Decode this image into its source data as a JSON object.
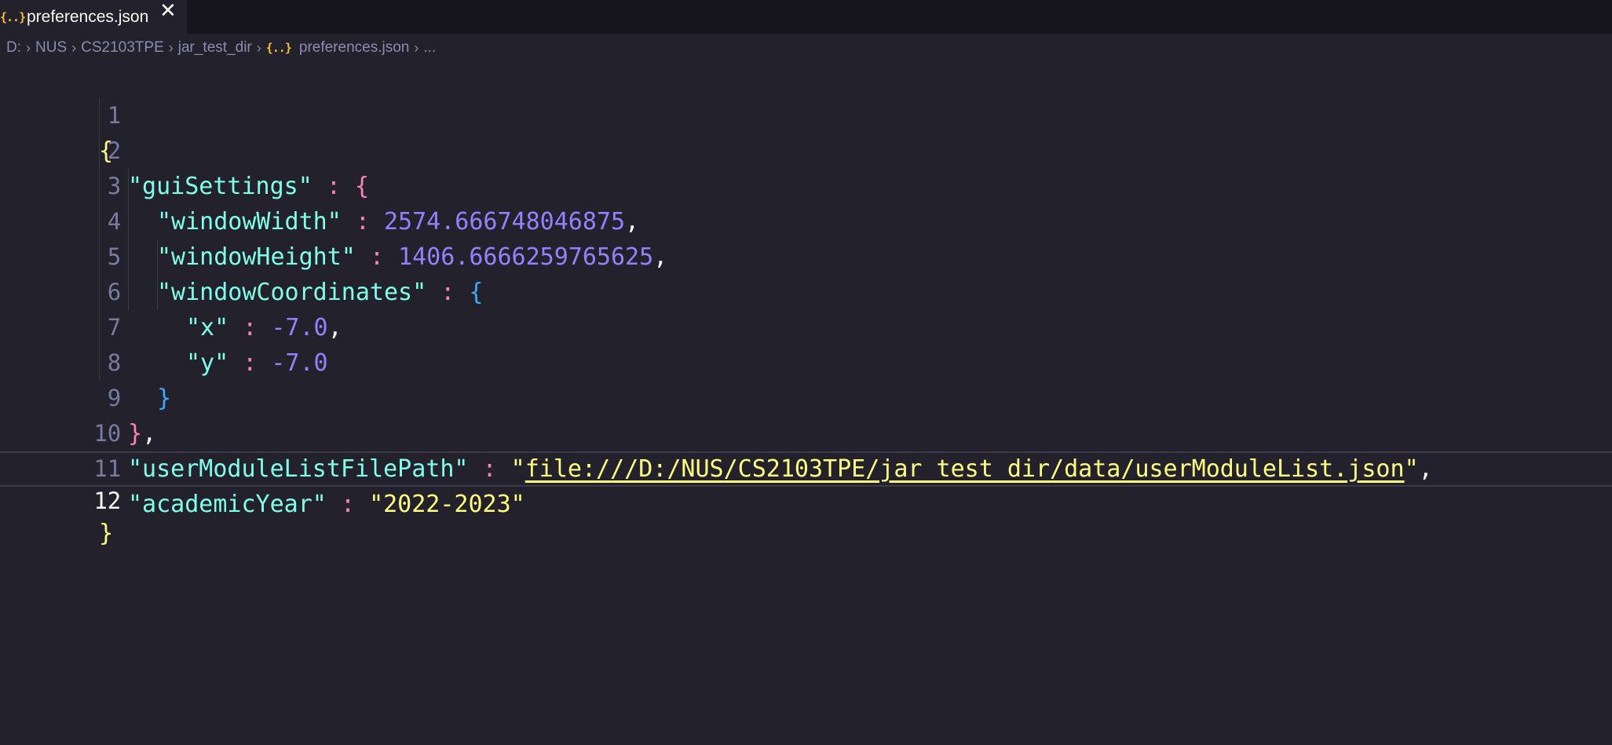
{
  "tab": {
    "icon": "{..}",
    "label": "preferences.json",
    "close": "✕"
  },
  "breadcrumb": {
    "items": [
      "D:",
      "NUS",
      "CS2103TPE",
      "jar_test_dir"
    ],
    "file_icon": "{..}",
    "file": "preferences.json",
    "tail": "..."
  },
  "editor": {
    "current_line": 12,
    "lines": [
      {
        "num": "1"
      },
      {
        "num": "2",
        "key": "\"guiSettings\"",
        "colon": ":",
        "open": "{"
      },
      {
        "num": "3",
        "key": "\"windowWidth\"",
        "colon": ":",
        "value": "2574.666748046875",
        "comma": ","
      },
      {
        "num": "4",
        "key": "\"windowHeight\"",
        "colon": ":",
        "value": "1406.6666259765625",
        "comma": ","
      },
      {
        "num": "5",
        "key": "\"windowCoordinates\"",
        "colon": ":",
        "open": "{"
      },
      {
        "num": "6",
        "key": "\"x\"",
        "colon": ":",
        "value": "-7.0",
        "comma": ","
      },
      {
        "num": "7",
        "key": "\"y\"",
        "colon": ":",
        "value": "-7.0"
      },
      {
        "num": "8",
        "close": "}"
      },
      {
        "num": "9",
        "close": "}",
        "comma": ","
      },
      {
        "num": "10",
        "key": "\"userModuleListFilePath\"",
        "colon": ":",
        "quote_open": "\"",
        "link": "file:///D:/NUS/CS2103TPE/jar_test_dir/data/userModuleList.json",
        "quote_close": "\"",
        "comma": ","
      },
      {
        "num": "11",
        "key": "\"academicYear\"",
        "colon": ":",
        "value": "\"2022-2023\""
      },
      {
        "num": "12",
        "close": "}"
      }
    ],
    "root_open": "{"
  },
  "colors": {
    "background": "#22212c",
    "tabbar": "#17161d",
    "key": "#80ffea",
    "number": "#9580ff",
    "string": "#ffff80",
    "punctuation": "#ff80bf",
    "bracket_level_3": "#3ea7ff"
  }
}
